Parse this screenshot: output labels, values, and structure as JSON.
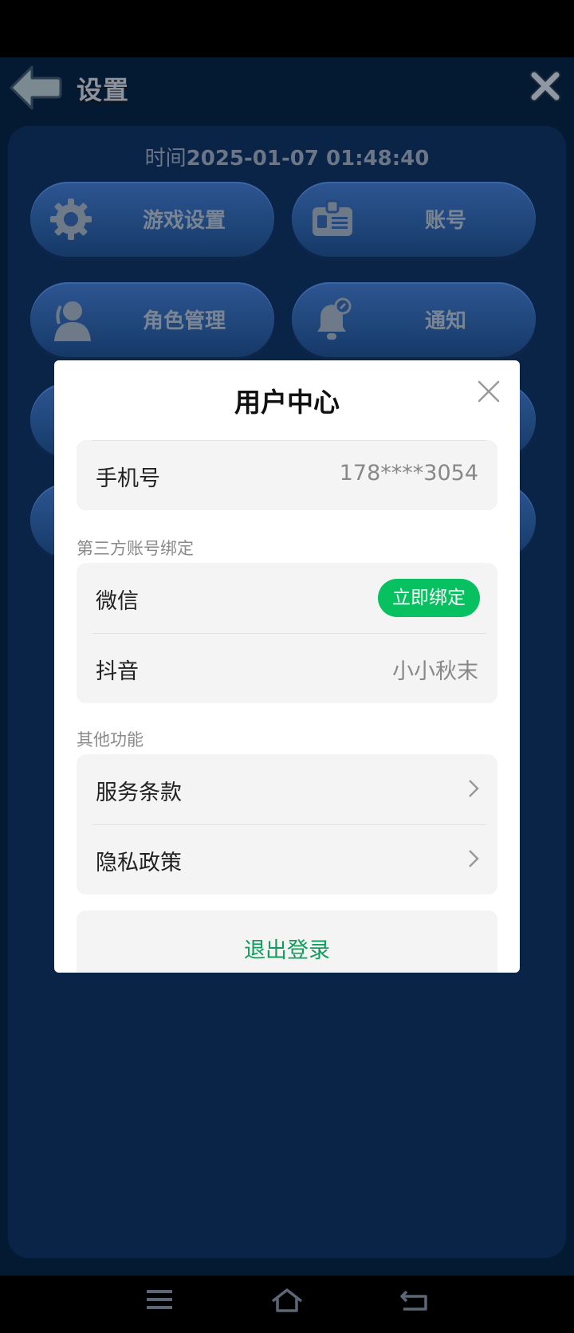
{
  "header": {
    "title": "设置"
  },
  "panel": {
    "time_label": "时间",
    "time_value": "2025-01-07 01:48:40",
    "buttons": [
      {
        "label": "游戏设置",
        "icon": "gear-icon"
      },
      {
        "label": "账号",
        "icon": "id-card-icon"
      },
      {
        "label": "角色管理",
        "icon": "person-icon"
      },
      {
        "label": "通知",
        "icon": "bell-icon"
      }
    ]
  },
  "modal": {
    "title": "用户中心",
    "phone": {
      "label": "手机号",
      "value": "178****3054"
    },
    "third_party_section": "第三方账号绑定",
    "wechat": {
      "label": "微信",
      "button": "立即绑定"
    },
    "douyin": {
      "label": "抖音",
      "value": "小小秋末"
    },
    "other_section": "其他功能",
    "terms": {
      "label": "服务条款"
    },
    "privacy": {
      "label": "隐私政策"
    },
    "logout": "退出登录"
  },
  "colors": {
    "game_background": "#041a33",
    "panel": "#0a2448",
    "button": "#1f4579",
    "accent_green": "#07c160",
    "logout_green": "#129d5e"
  }
}
